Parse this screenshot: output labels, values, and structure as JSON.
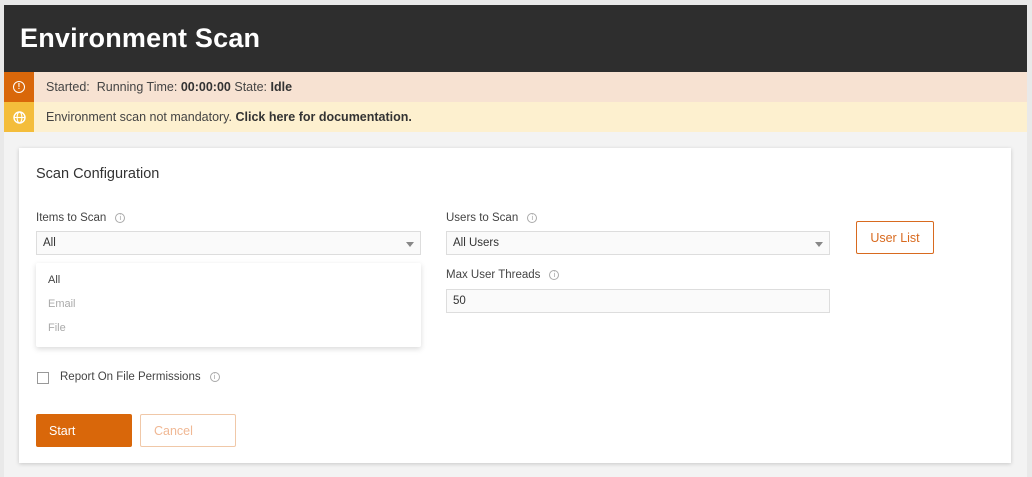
{
  "header": {
    "title": "Environment Scan"
  },
  "status": {
    "started_label": "Started:",
    "running_label": "Running Time:",
    "running_value": "00:00:00",
    "state_label": "State:",
    "state_value": "Idle",
    "icon": "info-icon",
    "color": "#d9670a"
  },
  "notice": {
    "text": "Environment scan not mandatory.",
    "link": "Click here for documentation.",
    "icon": "globe-icon",
    "color": "#f4bd3b"
  },
  "card": {
    "title": "Scan Configuration",
    "items": {
      "label": "Items to Scan",
      "value": "All",
      "options": [
        "All",
        "Email",
        "File"
      ]
    },
    "users": {
      "label": "Users to Scan",
      "value": "All Users"
    },
    "user_list_button": "User List",
    "threads": {
      "label": "Max User Threads",
      "value": "50"
    },
    "report": {
      "label": "Report On File Permissions",
      "checked": false
    },
    "start_button": "Start",
    "cancel_button": "Cancel"
  },
  "colors": {
    "accent": "#d9670a",
    "header_bg": "#2e2e2e"
  }
}
